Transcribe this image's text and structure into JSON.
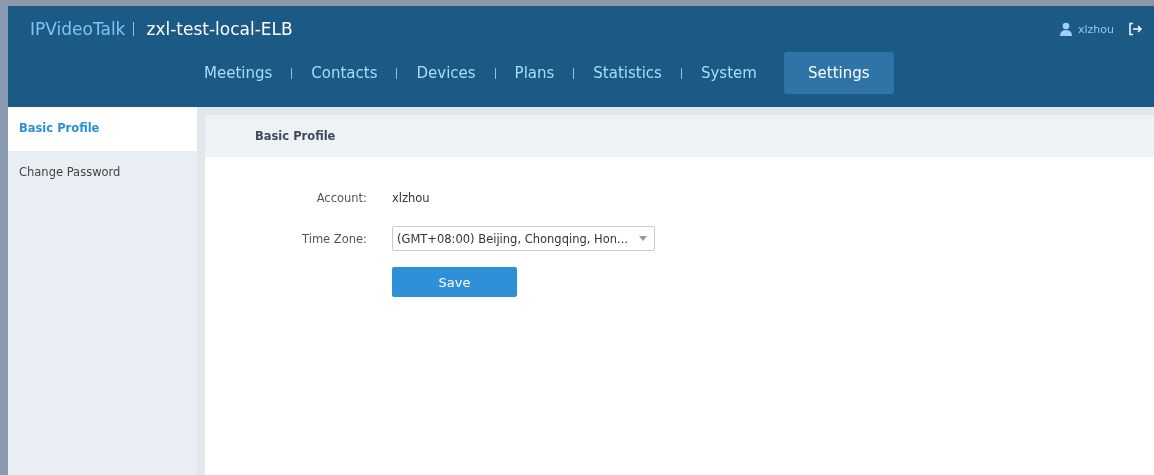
{
  "header": {
    "brand": "IPVideoTalk",
    "title": "zxl-test-local-ELB",
    "user": "xlzhou"
  },
  "nav": [
    {
      "label": "Meetings",
      "selected": false
    },
    {
      "label": "Contacts",
      "selected": false
    },
    {
      "label": "Devices",
      "selected": false
    },
    {
      "label": "Plans",
      "selected": false
    },
    {
      "label": "Statistics",
      "selected": false
    },
    {
      "label": "System",
      "selected": false
    },
    {
      "label": "Settings",
      "selected": true
    }
  ],
  "sidebar": {
    "items": [
      {
        "label": "Basic Profile",
        "selected": true
      },
      {
        "label": "Change Password",
        "selected": false
      }
    ]
  },
  "panel": {
    "title": "Basic Profile",
    "account": {
      "label": "Account:",
      "value": "xlzhou"
    },
    "time_zone": {
      "label": "Time Zone:",
      "value": "(GMT+08:00) Beijing, Chongqing, Hon..."
    },
    "save_button": "Save"
  }
}
